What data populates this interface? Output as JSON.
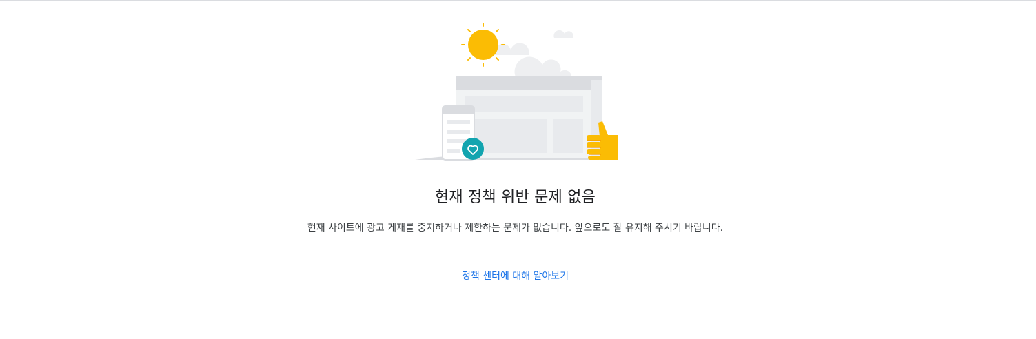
{
  "empty_state": {
    "title": "현재 정책 위반 문제 없음",
    "description": "현재 사이트에 광고 게재를 중지하거나 제한하는 문제가 없습니다. 앞으로도 잘 유지해 주시기 바랍니다.",
    "link_label": "정책 센터에 대해 알아보기"
  },
  "illustration": {
    "icons": [
      "sun-icon",
      "cloud-icon",
      "browser-window-icon",
      "mobile-device-icon",
      "heart-icon",
      "thumbs-up-icon"
    ],
    "colors": {
      "sun": "#fbbc04",
      "cloud": "#eeeff1",
      "window_frame": "#dadce0",
      "window_body": "#f1f3f4",
      "heart_badge": "#12a4af",
      "thumb": "#fbbc04",
      "thumb_shade": "#f29900"
    }
  },
  "colors": {
    "link": "#1a73e8",
    "title_text": "#202124",
    "body_text": "#3c4043",
    "divider": "#dadce0"
  }
}
